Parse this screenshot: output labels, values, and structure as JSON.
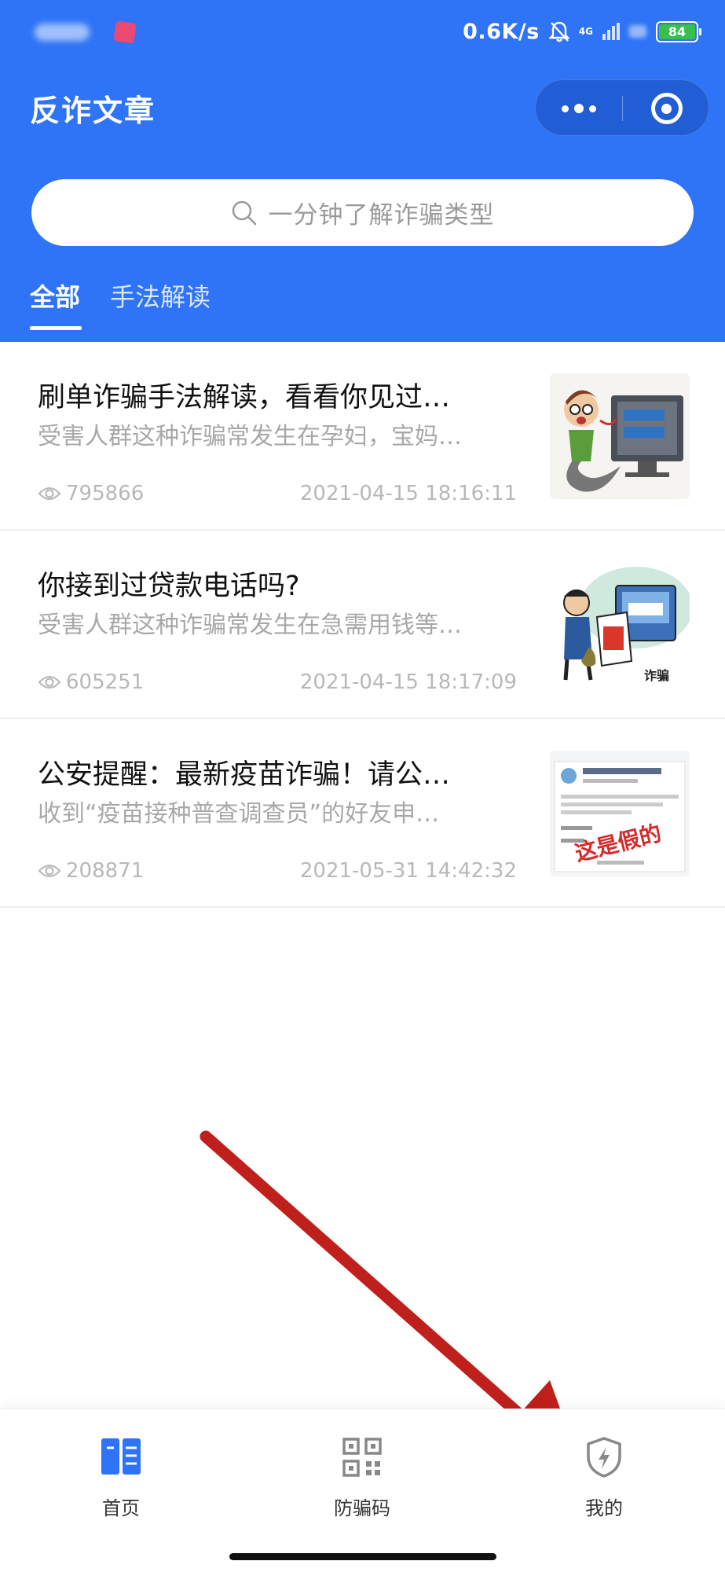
{
  "status_bar": {
    "network_speed": "0.6K/s",
    "network_type": "4G",
    "battery": "84"
  },
  "header": {
    "title": "反诈文章"
  },
  "search": {
    "placeholder": "一分钟了解诈骗类型"
  },
  "tabs": [
    {
      "label": "全部",
      "active": true
    },
    {
      "label": "手法解读",
      "active": false
    }
  ],
  "articles": [
    {
      "title": "刷单诈骗手法解读，看看你见过…",
      "summary": "受害人群这种诈骗常发生在孕妇，宝妈…",
      "views": "795866",
      "date": "2021-04-15 18:16:11"
    },
    {
      "title": "你接到过贷款电话吗?",
      "summary": "受害人群这种诈骗常发生在急需用钱等…",
      "views": "605251",
      "date": "2021-04-15 18:17:09"
    },
    {
      "title": "公安提醒：最新疫苗诈骗！请公…",
      "summary": "收到“疫苗接种普查调查员”的好友申…",
      "views": "208871",
      "date": "2021-05-31 14:42:32"
    }
  ],
  "thumb_texts": {
    "fake_stamp": "这是假的",
    "scam_label": "诈骗"
  },
  "bottom_nav": [
    {
      "label": "首页",
      "icon": "book-icon",
      "active": true
    },
    {
      "label": "防骗码",
      "icon": "qr-code-icon",
      "active": false
    },
    {
      "label": "我的",
      "icon": "shield-icon",
      "active": false
    }
  ],
  "colors": {
    "brand_blue": "#2f73f6",
    "annotation_arrow": "#c0201b"
  }
}
